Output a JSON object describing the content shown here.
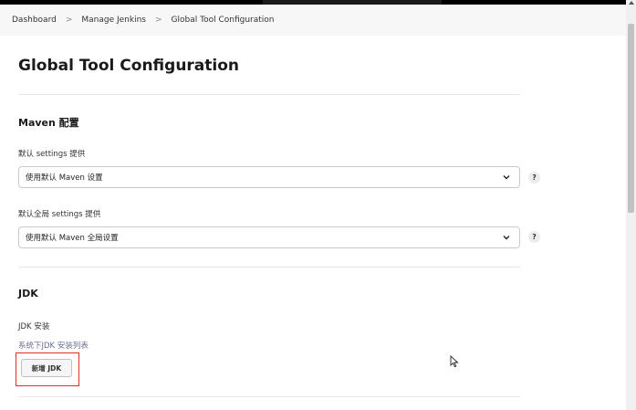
{
  "breadcrumb": {
    "items": [
      "Dashboard",
      "Manage Jenkins",
      "Global Tool Configuration"
    ],
    "separator": ">"
  },
  "page": {
    "title": "Global Tool Configuration"
  },
  "maven": {
    "section_title": "Maven 配置",
    "settings_label": "默认 settings 提供",
    "settings_value": "使用默认 Maven 设置",
    "global_settings_label": "默认全局 settings 提供",
    "global_settings_value": "使用默认 Maven 全局设置",
    "help_label": "?"
  },
  "jdk": {
    "section_title": "JDK",
    "install_label": "JDK 安装",
    "install_list_label": "系统下JDK 安装列表",
    "add_button": "新增 JDK"
  },
  "colors": {
    "highlight": "#e03030",
    "link": "#6a6f8f"
  },
  "icons": [
    "chevron-down-icon",
    "help-icon",
    "mouse-cursor-icon"
  ]
}
